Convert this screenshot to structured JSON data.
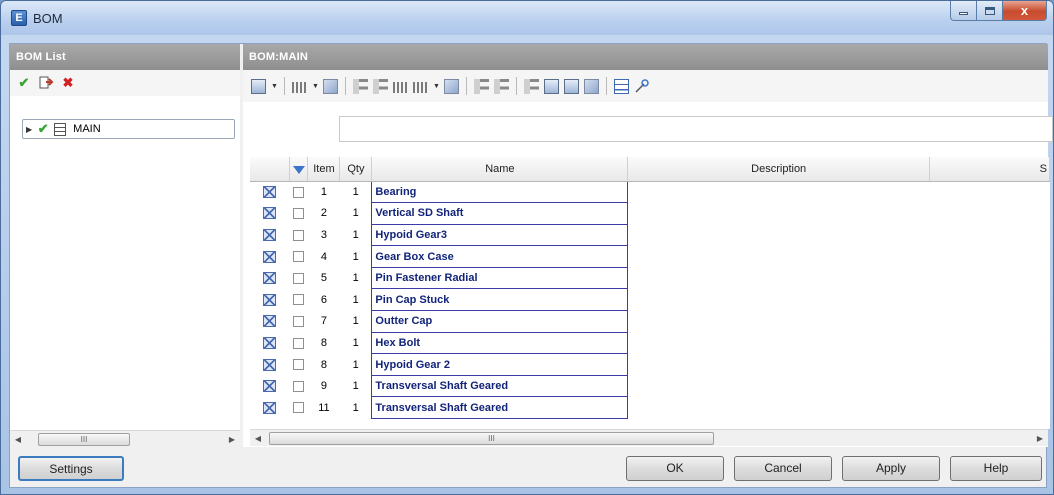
{
  "window": {
    "title": "BOM",
    "icon": "bom-app-icon",
    "close_symbol": "x"
  },
  "left_panel": {
    "header": "BOM List",
    "toolbar_icons": [
      "check-icon",
      "export-icon",
      "delete-icon"
    ],
    "tree": [
      {
        "label": "MAIN",
        "icons": [
          "expand-arrow-icon",
          "check-icon",
          "table-icon"
        ]
      }
    ],
    "scroll_thumb": "III"
  },
  "main_panel": {
    "header": "BOM:MAIN",
    "filter_text": "",
    "columns": [
      "",
      "",
      "Item",
      "Qty",
      "Name",
      "Description",
      "S"
    ],
    "rows": [
      {
        "item": "1",
        "qty": "1",
        "name": "Bearing"
      },
      {
        "item": "2",
        "qty": "1",
        "name": "Vertical SD Shaft"
      },
      {
        "item": "3",
        "qty": "1",
        "name": "Hypoid Gear3"
      },
      {
        "item": "4",
        "qty": "1",
        "name": "Gear Box Case"
      },
      {
        "item": "5",
        "qty": "1",
        "name": "Pin Fastener Radial"
      },
      {
        "item": "6",
        "qty": "1",
        "name": "Pin Cap Stuck"
      },
      {
        "item": "7",
        "qty": "1",
        "name": "Outter Cap"
      },
      {
        "item": "8",
        "qty": "1",
        "name": "Hex Bolt"
      },
      {
        "item": "8",
        "qty": "1",
        "name": "Hypoid Gear 2"
      },
      {
        "item": "9",
        "qty": "1",
        "name": "Transversal Shaft Geared"
      },
      {
        "item": "11",
        "qty": "1",
        "name": "Transversal Shaft Geared"
      }
    ],
    "scroll_thumb": "III"
  },
  "buttons": {
    "settings": "Settings",
    "ok": "OK",
    "cancel": "Cancel",
    "apply": "Apply",
    "help": "Help"
  },
  "colors": {
    "panel_header": "#999999",
    "name_text": "#12247a",
    "name_border": "#3a3aa8",
    "close_button": "#c74a2c",
    "check": "#3aa535",
    "delete": "#d12020"
  }
}
